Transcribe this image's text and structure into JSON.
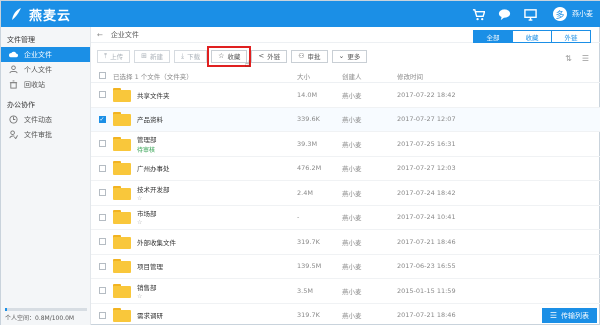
{
  "app": {
    "title": "燕麦云"
  },
  "topbar": {
    "icons": [
      "cart-icon",
      "chat-icon",
      "monitor-icon",
      "user-icon"
    ],
    "user_initial": "多",
    "user_name": "燕小麦"
  },
  "sidebar": {
    "sections": [
      {
        "title": "文件管理",
        "items": [
          {
            "label": "企业文件",
            "icon": "cloud-icon",
            "active": true
          },
          {
            "label": "个人文件",
            "icon": "person-icon",
            "active": false
          },
          {
            "label": "回收站",
            "icon": "trash-icon",
            "active": false
          }
        ]
      },
      {
        "title": "办公协作",
        "items": [
          {
            "label": "文件动态",
            "icon": "activity-icon",
            "active": false
          },
          {
            "label": "文件审批",
            "icon": "approval-icon",
            "active": false
          }
        ]
      }
    ],
    "storage": {
      "text": "个人空间：0.8M/100.0M",
      "fraction": 0.008
    }
  },
  "breadcrumb": {
    "back": "←",
    "current": "企业文件"
  },
  "view_tabs": [
    "全部",
    "收藏",
    "外链"
  ],
  "toolbar": {
    "buttons": [
      {
        "label": "上传",
        "icon": "upload-icon",
        "enabled": false
      },
      {
        "label": "新建",
        "icon": "new-folder-icon",
        "enabled": false
      },
      {
        "label": "下载",
        "icon": "download-icon",
        "enabled": false
      },
      {
        "label": "收藏",
        "icon": "star-icon",
        "enabled": true,
        "highlight": true
      },
      {
        "label": "外链",
        "icon": "share-icon",
        "enabled": true
      },
      {
        "label": "审批",
        "icon": "approval-icon",
        "enabled": true
      },
      {
        "label": "更多",
        "icon": "chevron-down-icon",
        "enabled": true
      }
    ]
  },
  "table": {
    "header": {
      "selection": "已选择 1 个文件（文件夹）",
      "size": "大小",
      "owner": "创建人",
      "date": "修改时间"
    },
    "rows": [
      {
        "name": "共享文件夹",
        "sub": "",
        "size": "14.0M",
        "owner": "燕小麦",
        "date": "2017-07-22 18:42",
        "checked": false
      },
      {
        "name": "产品资料",
        "sub": "",
        "size": "339.6K",
        "owner": "燕小麦",
        "date": "2017-07-27 12:07",
        "checked": true
      },
      {
        "name": "管理部",
        "sub": "待审核",
        "size": "39.3M",
        "owner": "燕小麦",
        "date": "2017-07-25 16:31",
        "checked": false
      },
      {
        "name": "广州办事处",
        "sub": "",
        "size": "476.2M",
        "owner": "燕小麦",
        "date": "2017-07-27 12:03",
        "checked": false
      },
      {
        "name": "技术开发部",
        "sub": "☆",
        "size": "2.4M",
        "owner": "燕小麦",
        "date": "2017-07-24 18:42",
        "checked": false
      },
      {
        "name": "市场部",
        "sub": "☆",
        "size": "-",
        "owner": "燕小麦",
        "date": "2017-07-24 10:41",
        "checked": false
      },
      {
        "name": "外部收集文件",
        "sub": "",
        "size": "319.7K",
        "owner": "燕小麦",
        "date": "2017-07-21 18:46",
        "checked": false
      },
      {
        "name": "项目管理",
        "sub": "",
        "size": "139.5M",
        "owner": "燕小麦",
        "date": "2017-06-23 16:55",
        "checked": false
      },
      {
        "name": "销售部",
        "sub": "☆",
        "size": "3.5M",
        "owner": "燕小麦",
        "date": "2015-01-15 11:59",
        "checked": false
      },
      {
        "name": "需求调研",
        "sub": "",
        "size": "319.7K",
        "owner": "燕小麦",
        "date": "2017-07-21 18:46",
        "checked": false
      }
    ]
  },
  "transfer_button": {
    "label": "传输列表",
    "icon": "list-icon"
  },
  "colors": {
    "brand": "#1b8fe6",
    "folder": "#f9c73b",
    "highlight": "#e02020",
    "approval": "#2a9d4a"
  }
}
